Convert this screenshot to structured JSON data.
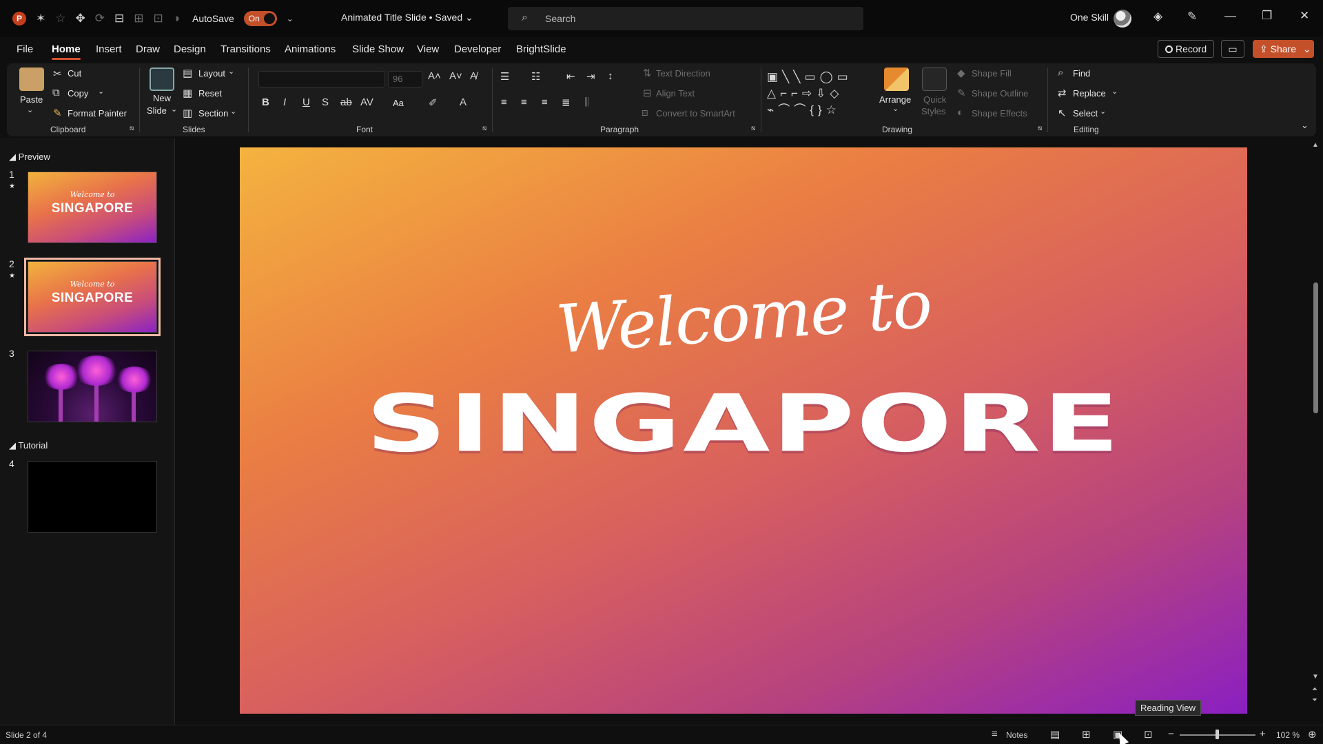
{
  "titlebar": {
    "autosave_label": "AutoSave",
    "autosave_state": "On",
    "document_title": "Animated Title Slide • Saved",
    "search_placeholder": "Search",
    "user_name": "One Skill"
  },
  "tabs": [
    "File",
    "Home",
    "Insert",
    "Draw",
    "Design",
    "Transitions",
    "Animations",
    "Slide Show",
    "View",
    "Developer",
    "BrightSlide"
  ],
  "active_tab": "Home",
  "actions": {
    "record": "Record",
    "share": "Share"
  },
  "ribbon": {
    "clipboard": {
      "label": "Clipboard",
      "paste": "Paste",
      "cut": "Cut",
      "copy": "Copy",
      "format_painter": "Format Painter"
    },
    "slides": {
      "label": "Slides",
      "new_slide_line1": "New",
      "new_slide_line2": "Slide",
      "layout": "Layout",
      "reset": "Reset",
      "section": "Section"
    },
    "font": {
      "label": "Font",
      "size": "96",
      "change_case": "Aa"
    },
    "paragraph": {
      "label": "Paragraph",
      "text_direction": "Text Direction",
      "align_text": "Align Text",
      "convert_smartart": "Convert to SmartArt"
    },
    "drawing": {
      "label": "Drawing",
      "arrange": "Arrange",
      "quick_styles_line1": "Quick",
      "quick_styles_line2": "Styles",
      "shape_fill": "Shape Fill",
      "shape_outline": "Shape Outline",
      "shape_effects": "Shape Effects"
    },
    "editing": {
      "label": "Editing",
      "find": "Find",
      "replace": "Replace",
      "select": "Select"
    }
  },
  "slide_panel": {
    "sections": [
      "Preview",
      "Tutorial"
    ],
    "slides": [
      {
        "number": "1",
        "welcome": "Welcome to",
        "title": "SINGAPORE"
      },
      {
        "number": "2",
        "welcome": "Welcome to",
        "title": "SINGAPORE"
      },
      {
        "number": "3"
      },
      {
        "number": "4"
      }
    ],
    "selected_slide": 2
  },
  "slide": {
    "welcome": "Welcome to",
    "title": "SINGAPORE",
    "colors": [
      "#f4b33f",
      "#ea7e43",
      "#d8605e",
      "#b6427f",
      "#8a1fc2"
    ]
  },
  "tooltip": "Reading View",
  "statusbar": {
    "slide_counter": "Slide 2 of 4",
    "notes": "Notes",
    "zoom": "102 %"
  },
  "colors": {
    "accent": "#c4502a",
    "tab_underline": "#d35230",
    "background": "#0f0f0f",
    "ribbon": "#1c1c1c"
  }
}
